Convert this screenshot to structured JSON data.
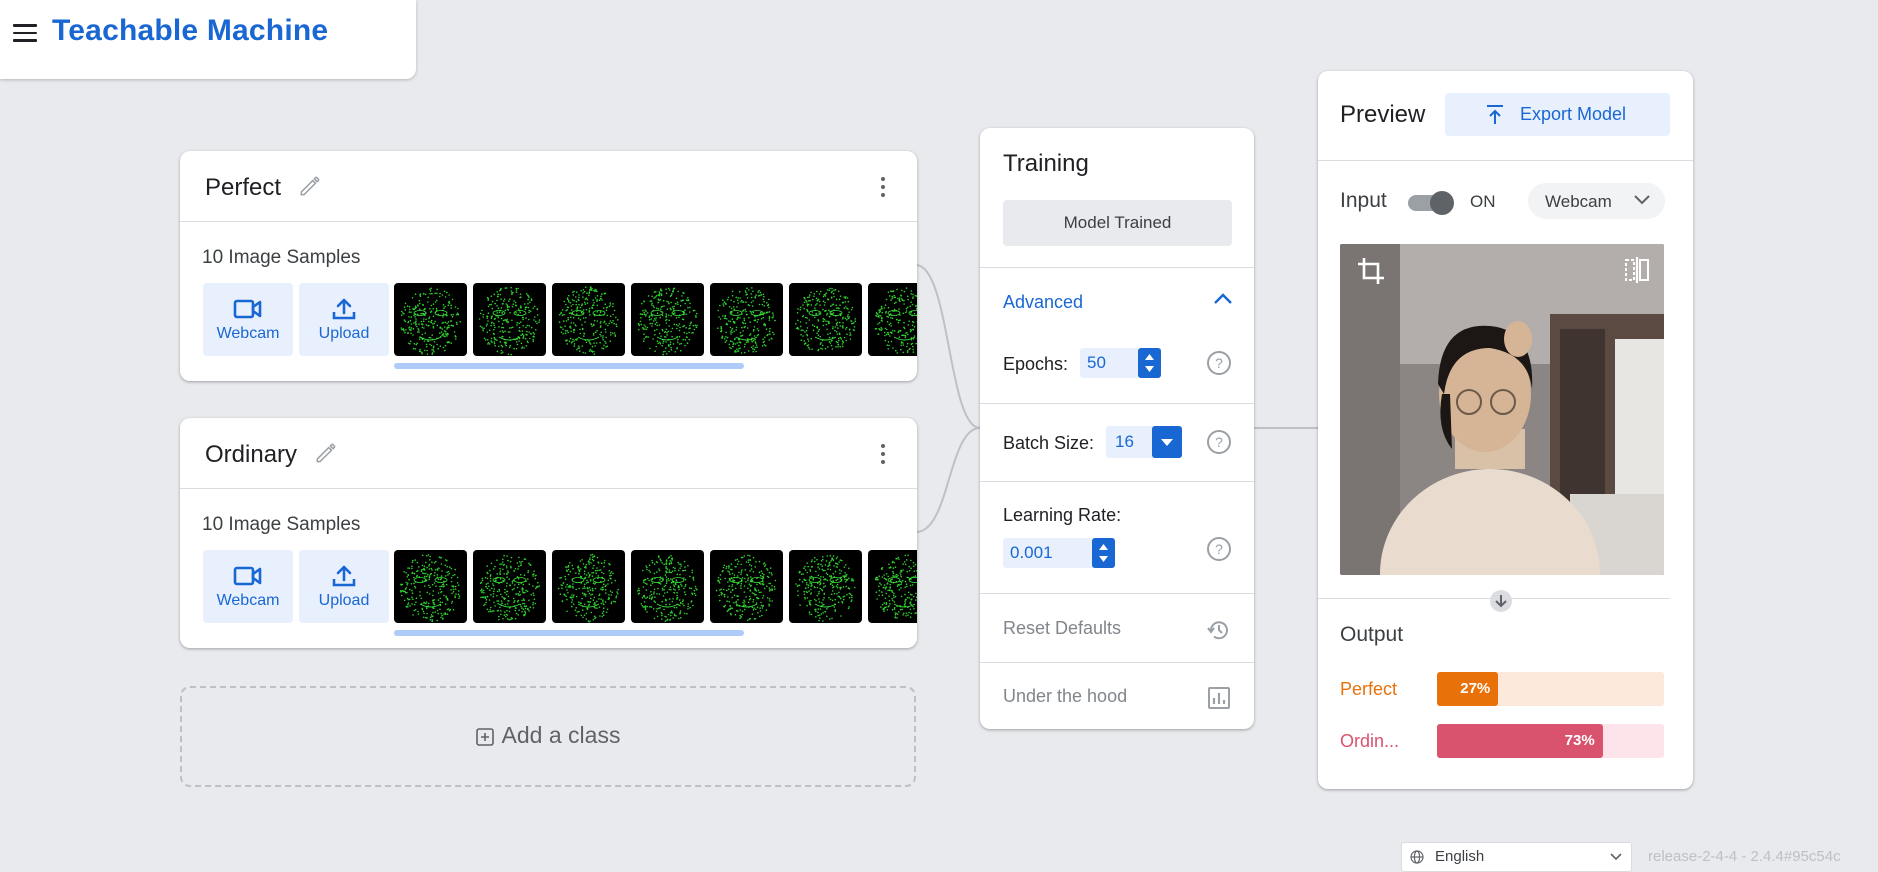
{
  "app": {
    "title": "Teachable Machine"
  },
  "classes": [
    {
      "name": "Perfect",
      "samples": "10 Image Samples",
      "webcam_label": "Webcam",
      "upload_label": "Upload"
    },
    {
      "name": "Ordinary",
      "samples": "10 Image Samples",
      "webcam_label": "Webcam",
      "upload_label": "Upload"
    }
  ],
  "add_class": {
    "label": "Add a class"
  },
  "training": {
    "title": "Training",
    "status_button": "Model Trained",
    "advanced_label": "Advanced",
    "epochs_label": "Epochs:",
    "epochs_value": "50",
    "batch_label": "Batch Size:",
    "batch_value": "16",
    "lr_label": "Learning Rate:",
    "lr_value": "0.001",
    "reset_label": "Reset Defaults",
    "hood_label": "Under the hood"
  },
  "preview": {
    "title": "Preview",
    "export_label": "Export Model",
    "input_label": "Input",
    "toggle_state": "ON",
    "source": "Webcam",
    "output_label": "Output",
    "outputs": [
      {
        "label": "Perfect",
        "percent_text": "27%",
        "value": 0.27,
        "color": "#e8710a",
        "track": "#fde8dc"
      },
      {
        "label": "Ordin...",
        "percent_text": "73%",
        "value": 0.73,
        "color": "#d9536f",
        "track": "#fce4ea"
      }
    ]
  },
  "footer": {
    "language": "English",
    "version": "release-2-4-4 - 2.4.4#95c54c"
  },
  "colors": {
    "accent": "#1967d2",
    "accent_light": "#e8f0fe",
    "background": "#e8eaed"
  }
}
